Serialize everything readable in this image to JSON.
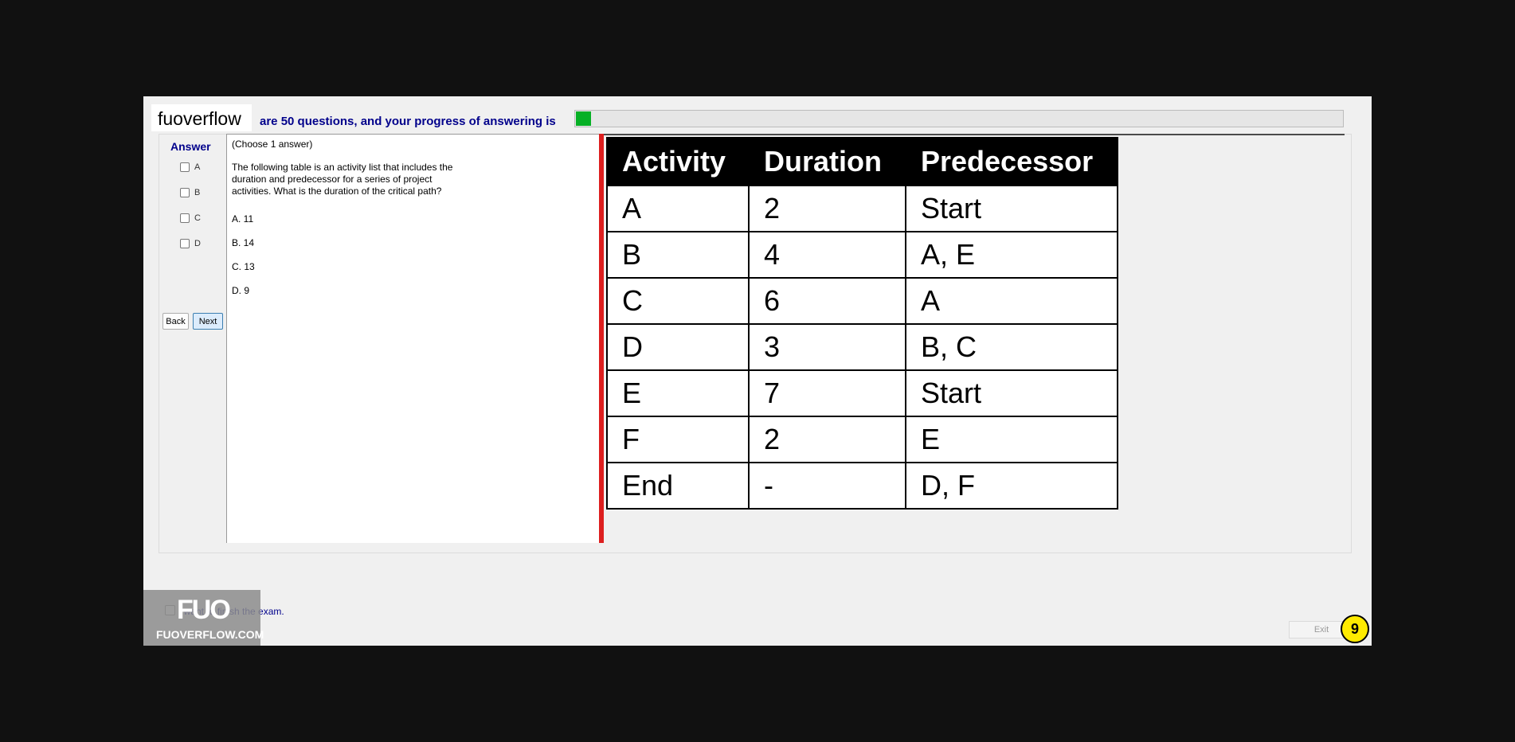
{
  "header": {
    "logo_text": "fuoverflow",
    "progress_label": "are 50 questions, and your progress of answering is",
    "progress_value": 0.02,
    "progress_color": "#06b025"
  },
  "answer_panel": {
    "title": "Answer",
    "options": [
      "A",
      "B",
      "C",
      "D"
    ],
    "back_label": "Back",
    "next_label": "Next"
  },
  "question": {
    "instruction": "(Choose 1 answer)",
    "text_lines": [
      "The following table is an activity list that includes the",
      "duration and predecessor for a series of project",
      "activities. What is the duration of the critical path?"
    ],
    "choices": [
      "A.  11",
      "B.  14",
      "C.  13",
      "D.  9"
    ]
  },
  "activity_table": {
    "headers": [
      "Activity",
      "Duration",
      "Predecessor"
    ],
    "rows": [
      [
        "A",
        "2",
        "Start"
      ],
      [
        "B",
        "4",
        "A, E"
      ],
      [
        "C",
        "6",
        "A"
      ],
      [
        "D",
        "3",
        "B, C"
      ],
      [
        "E",
        "7",
        "Start"
      ],
      [
        "F",
        "2",
        "E"
      ],
      [
        "End",
        "-",
        "D, F"
      ]
    ]
  },
  "footer": {
    "finish_text": "I want to finish the exam.",
    "exit_label": "Exit",
    "badge_number": "9",
    "badge_color": "#ffeb00"
  },
  "watermark": {
    "logo": "FUO",
    "site": "FUOVERFLOW.COM"
  }
}
